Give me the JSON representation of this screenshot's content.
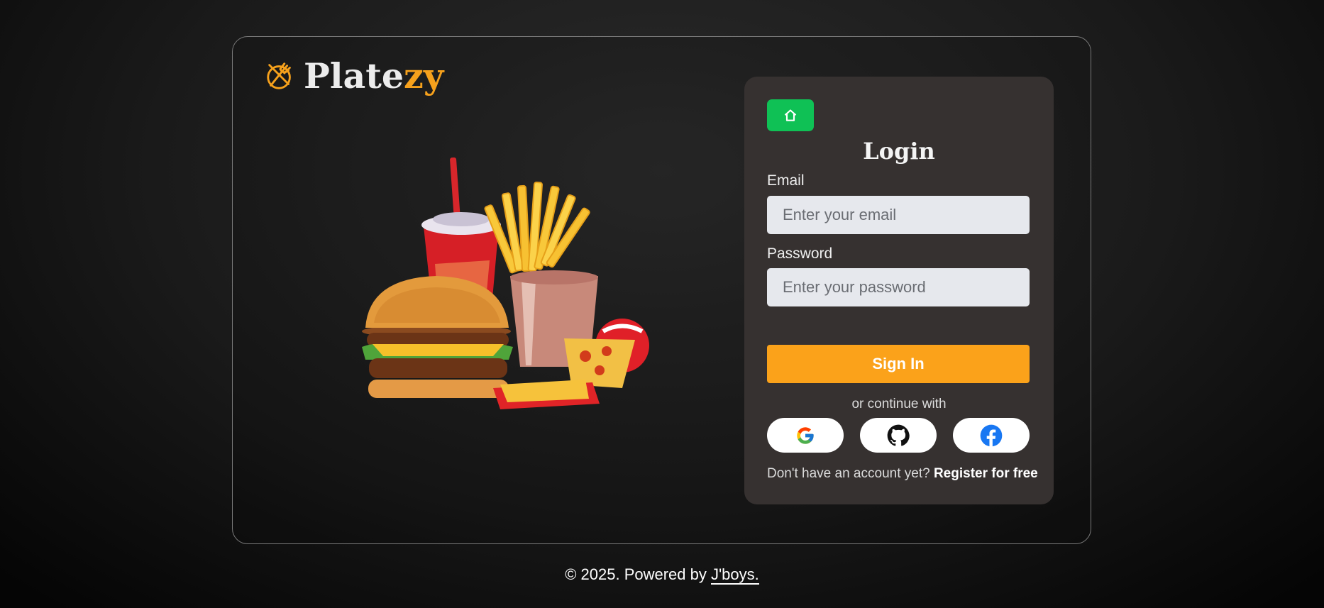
{
  "brand": {
    "part1": "Plate ",
    "part2": "zy",
    "accent": "#f6a11c"
  },
  "login": {
    "home_icon": "home-icon",
    "title": "Login",
    "email_label": "Email",
    "email_placeholder": "Enter your email",
    "email_value": "",
    "password_label": "Password",
    "password_placeholder": "Enter your password",
    "password_value": "",
    "signin_label": "Sign In",
    "signin_color": "#fba21a",
    "home_color": "#0fc155",
    "or_text": "or continue with",
    "social": [
      {
        "name": "google",
        "icon": "google-icon"
      },
      {
        "name": "github",
        "icon": "github-icon"
      },
      {
        "name": "facebook",
        "icon": "facebook-icon"
      }
    ],
    "register_prompt": "Don't have an account yet? ",
    "register_link": "Register for free"
  },
  "hero_image": {
    "icon": "fast-food-illustration"
  },
  "footer": {
    "text": "© 2025. Powered by ",
    "link": "J'boys."
  }
}
